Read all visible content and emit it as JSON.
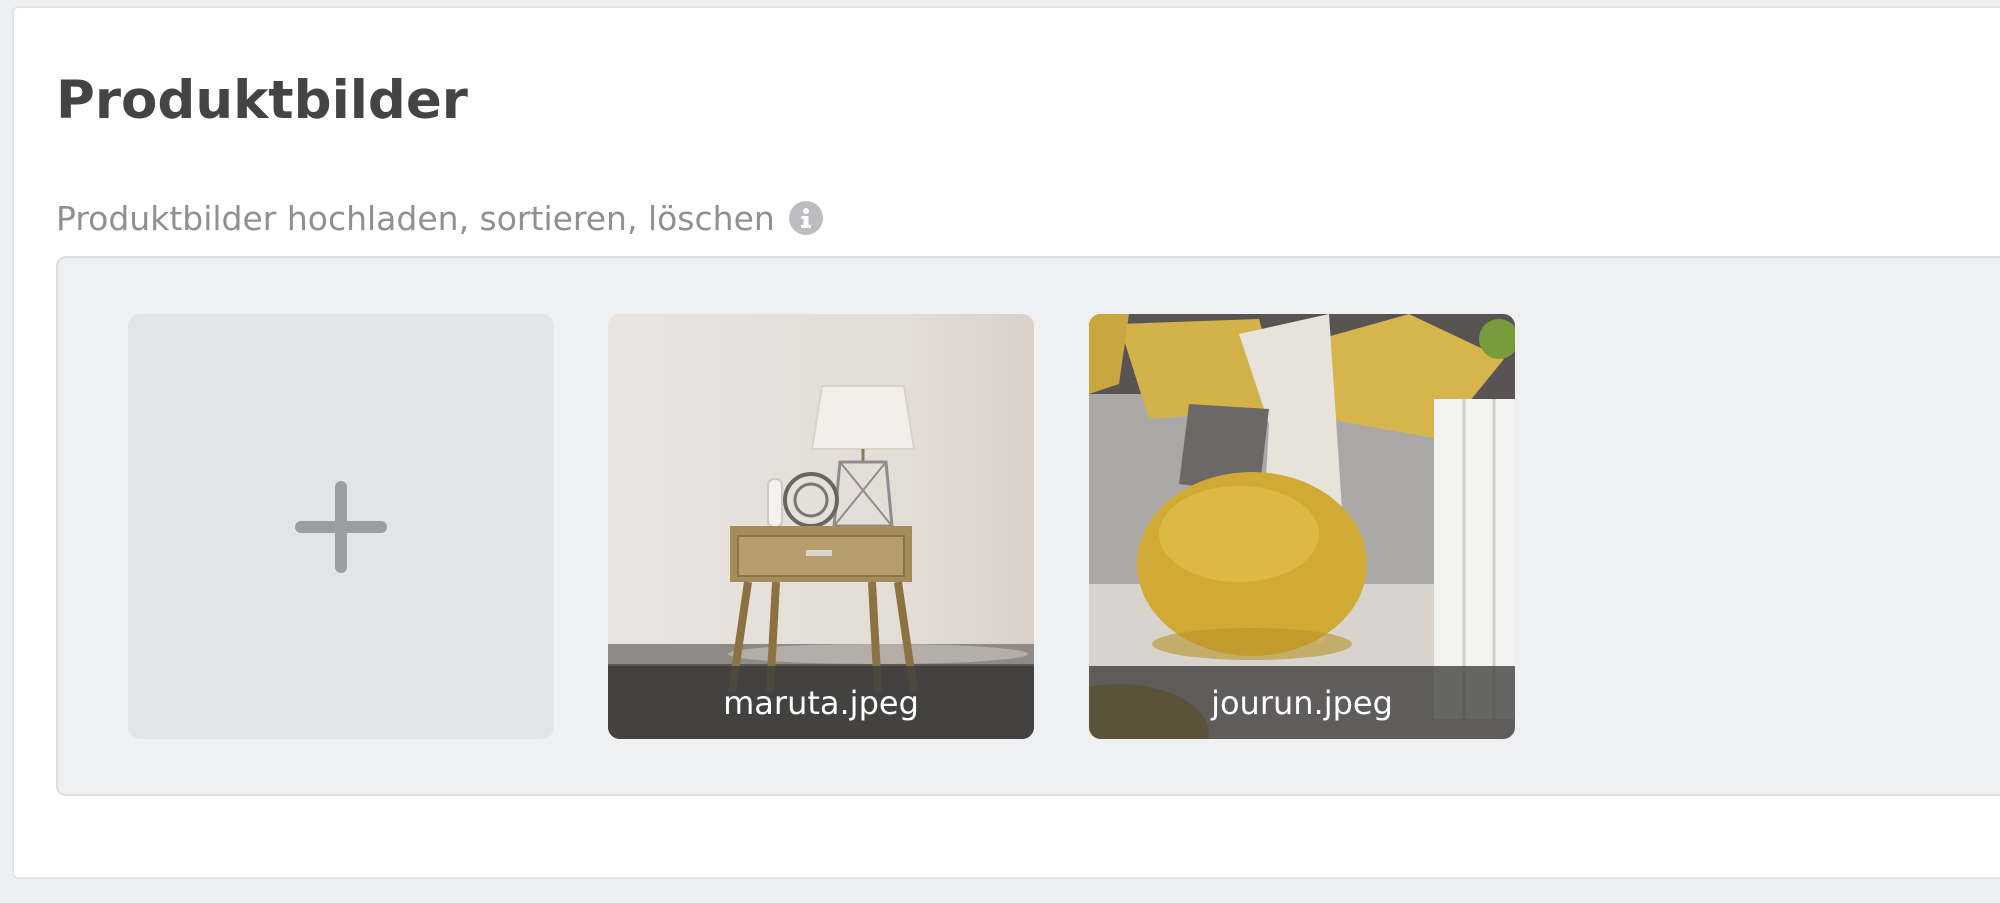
{
  "section": {
    "title": "Produktbilder",
    "subtitle": "Produktbilder hochladen, sortieren, löschen"
  },
  "icons": {
    "info": "info-icon",
    "add": "plus-icon"
  },
  "gallery": {
    "images": [
      {
        "filename": "maruta.jpeg"
      },
      {
        "filename": "jourun.jpeg"
      }
    ]
  },
  "colors": {
    "title": "#444444",
    "subtitle": "#8f9093",
    "gallery_bg": "#eff0f2",
    "add_tile_bg": "#e3e4e7",
    "plus": "#9c9da0",
    "caption_bg": "#3c3c3c"
  }
}
